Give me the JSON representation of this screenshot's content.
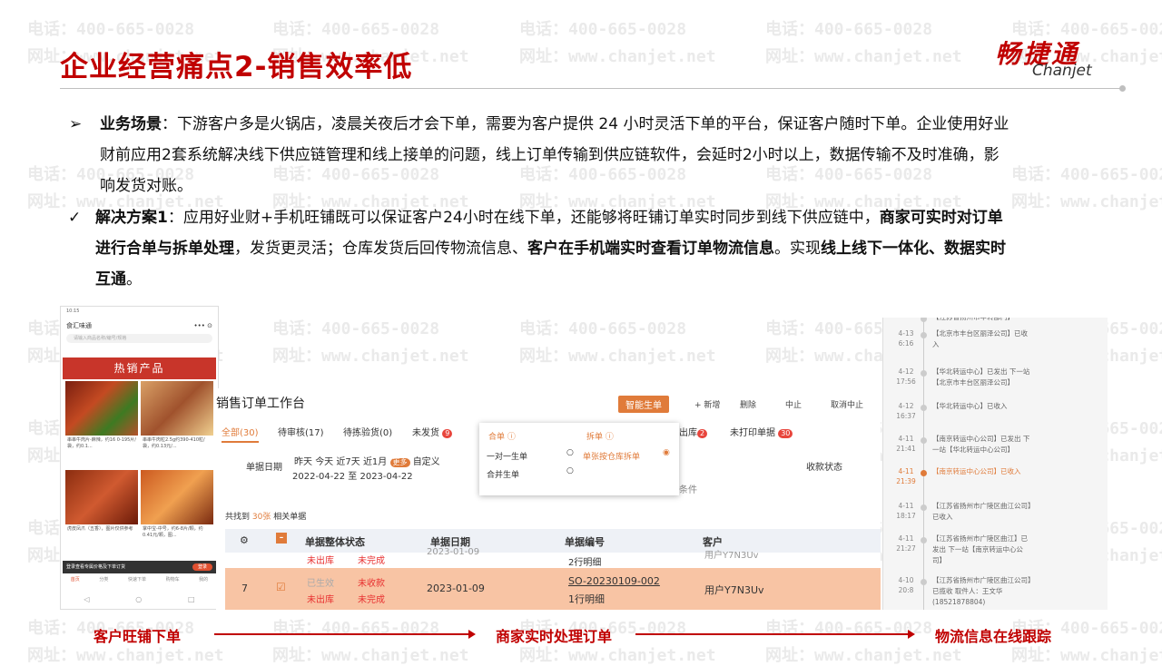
{
  "watermark": {
    "phone": "电话：400-665-0028",
    "site": "网址：www.chanjet.net"
  },
  "title": "企业经营痛点2-销售效率低",
  "logo": {
    "cn": "畅捷通",
    "en": "Chanjet"
  },
  "scenario": {
    "bullet": "➢",
    "label": "业务场景",
    "line1": "：下游客户多是火锅店，凌晨关夜后才会下单，需要为客户提供 24 小时灵活下单的平台，保证客户随时下单。企业使用好业",
    "line2": "财前应用2套系统解决线下供应链管理和线上接单的问题，线上订单传输到供应链软件，会延时2小时以上，数据传输不及时准确，影",
    "line3": "响发货对账。"
  },
  "solution": {
    "bullet": "✓",
    "label": "解决方案1",
    "part1": "：应用好业财+手机旺铺既可以保证客户24小时在线下单，还能够将旺铺订单实时同步到线下供应链中，",
    "bold1": "商家可实时对订单",
    "bold2": "进行合单与拆单处理",
    "part2": "，发货更灵活；仓库发货后回传物流信息、",
    "bold3": "客户在手机端实时查看订单物流信息",
    "part3": "。实现",
    "bold4": "线上线下一体化、数据实时",
    "bold5": "互通",
    "part4": "。"
  },
  "phone": {
    "time": "10:15",
    "app_name": "食汇味通",
    "search_placeholder": "请输入商品名称/编号/规格",
    "banner": "热销产品",
    "products": [
      {
        "name": "串串牛肉片",
        "desc": "串串牛肉片-麻辣，约16 0-195片/袋，约0.1..."
      },
      {
        "name": "串串牛肉粒",
        "desc": "串串牛肉粒2.5g约390-410粒/袋，约0.13元/..."
      },
      {
        "name": "虎皮凤爪（五香）",
        "desc": "虎皮凤爪（五香），图片仅供参考"
      },
      {
        "name": "掌中宝-中号",
        "desc": "掌中宝-中号，约6-8片/颗，约0.41元/颗，图..."
      }
    ],
    "login_text": "登录查看专属价格及下单订货",
    "login_button": "登录",
    "tabs": [
      "首页",
      "分类",
      "快速下单",
      "购物车",
      "我的"
    ],
    "nav": [
      "◁",
      "○",
      "□"
    ]
  },
  "erp": {
    "title": "销售订单工作台",
    "smart_button": "智能生单",
    "toolbar": [
      "+ 新增",
      "删除",
      "中止",
      "取消中止"
    ],
    "tabs": [
      {
        "label": "全部(30)"
      },
      {
        "label": "待审核(17)"
      },
      {
        "label": "待拣验货(0)"
      },
      {
        "label": "未发货",
        "badge": "9"
      },
      {
        "label": "出库",
        "badge": "2"
      },
      {
        "label": "未打印单据",
        "badge": "30"
      }
    ],
    "date_label": "单据日期",
    "date_options": [
      "昨天",
      "今天",
      "近7天",
      "近1月",
      "更多",
      "自定义"
    ],
    "date_range": "2022-04-22 至 2023-04-22",
    "collect_label": "收款状态",
    "more_conditions": "条件",
    "popup": {
      "merge": "合单 ⓘ",
      "split": "拆单 ⓘ",
      "merge_opt1": "一对一生单",
      "merge_opt2": "合并生单",
      "split_opt": "单张按仓库拆单"
    },
    "found": "共找到",
    "found_count": "30张",
    "found_suffix": "相关单据",
    "columns": [
      "单据整体状态",
      "单据日期",
      "单据编号",
      "客户"
    ],
    "prev_row": {
      "date": "2023-01-09",
      "lines": "2行明细",
      "customer": "用户Y7N3Uv"
    },
    "row": {
      "index": "7",
      "status1": "已生效",
      "flag1": "未收款",
      "flag2": "未出库",
      "flag3": "未完成",
      "date": "2023-01-09",
      "code": "SO-20230109-002",
      "lines": "1行明细",
      "customer": "用户Y7N3Uv"
    },
    "prev_flags": [
      "未出库",
      "未完成"
    ]
  },
  "logistics": [
    {
      "date": "",
      "time": "",
      "text": "【江苏省扬州市中转部门】"
    },
    {
      "date": "4-13",
      "time": "6:16",
      "text": "【北京市丰台区丽泽公司】已收入"
    },
    {
      "date": "4-12",
      "time": "17:56",
      "text": "【华北转运中心】已发出 下一站【北京市丰台区丽泽公司】"
    },
    {
      "date": "4-12",
      "time": "16:37",
      "text": "【华北转运中心】已收入"
    },
    {
      "date": "4-11",
      "time": "21:41",
      "text": "【南京转运中心公司】已发出 下一站【华北转运中心公司】"
    },
    {
      "date": "4-11",
      "time": "21:39",
      "text": "【南京转运中心公司】已收入"
    },
    {
      "date": "4-11",
      "time": "18:17",
      "text": "【江苏省扬州市广陵区曲江公司】已收入"
    },
    {
      "date": "4-11",
      "time": "21:27",
      "text": "【江苏省扬州市广陵区曲江】已发出 下一站【南京转运中心公司】"
    },
    {
      "date": "4-10",
      "time": "20:8",
      "text": "【江苏省扬州市广陵区曲江公司】已揽收 取件人：王文华 (18521878804)"
    }
  ],
  "steps": [
    "客户旺铺下单",
    "商家实时处理订单",
    "物流信息在线跟踪"
  ],
  "colors": {
    "accent": "#c00000",
    "orange": "#e07b3a"
  }
}
